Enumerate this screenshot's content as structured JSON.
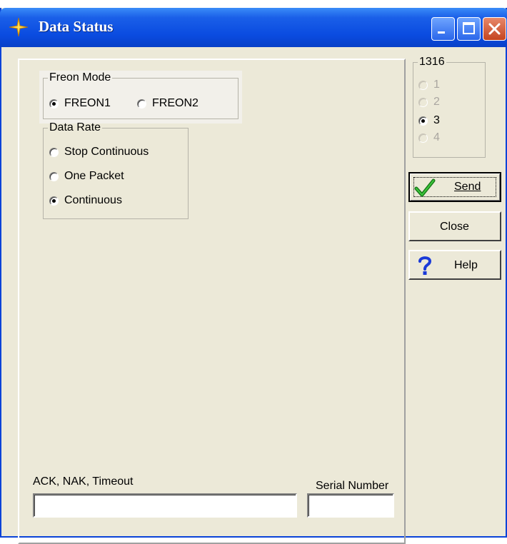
{
  "window": {
    "title": "Data Status"
  },
  "freon_mode": {
    "legend": "Freon Mode",
    "options": [
      {
        "label": "FREON1",
        "selected": true
      },
      {
        "label": "FREON2",
        "selected": false
      }
    ]
  },
  "data_rate": {
    "legend": "Data Rate",
    "options": [
      {
        "label": "Stop Continuous",
        "selected": false
      },
      {
        "label": "One Packet",
        "selected": false
      },
      {
        "label": "Continuous",
        "selected": true
      }
    ]
  },
  "unit_group": {
    "legend": "1316",
    "options": [
      {
        "label": "1",
        "selected": false,
        "enabled": false
      },
      {
        "label": "2",
        "selected": false,
        "enabled": false
      },
      {
        "label": "3",
        "selected": true,
        "enabled": true
      },
      {
        "label": "4",
        "selected": false,
        "enabled": false
      }
    ]
  },
  "buttons": {
    "send": "Send",
    "close": "Close",
    "help": "Help"
  },
  "status": {
    "ack_label": "ACK, NAK, Timeout",
    "ack_value": "",
    "serial_label": "Serial Number",
    "serial_value": ""
  },
  "icons": {
    "title": "crosshair-star-icon",
    "send": "checkmark-icon",
    "help": "question-mark-icon"
  }
}
